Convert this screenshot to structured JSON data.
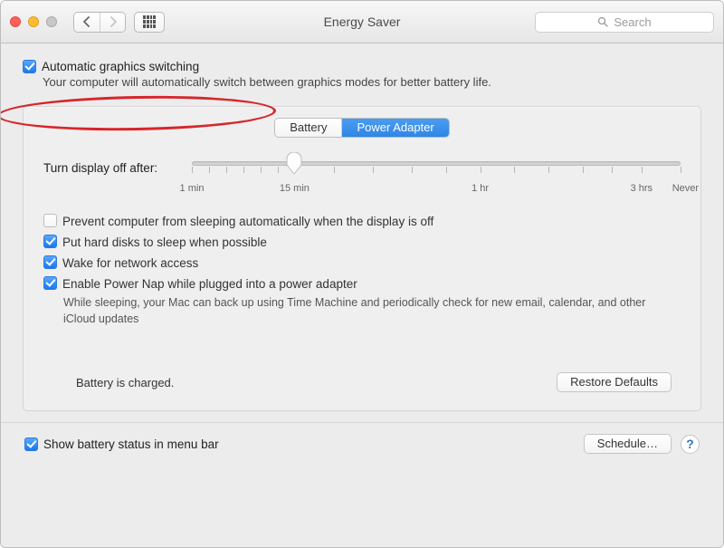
{
  "window": {
    "title": "Energy Saver"
  },
  "search": {
    "placeholder": "Search"
  },
  "auto_graphics": {
    "label": "Automatic graphics switching",
    "checked": true,
    "description": "Your computer will automatically switch between graphics modes for better battery life."
  },
  "tabs": {
    "battery": "Battery",
    "power_adapter": "Power Adapter",
    "active": "power_adapter"
  },
  "slider": {
    "label": "Turn display off after:",
    "ticks": {
      "min": "1 min",
      "mid": "15 min",
      "hour": "1 hr",
      "max": "3 hrs",
      "never": "Never"
    },
    "value_pct": 21
  },
  "options": {
    "prevent_sleep": {
      "label": "Prevent computer from sleeping automatically when the display is off",
      "checked": false
    },
    "hdd_sleep": {
      "label": "Put hard disks to sleep when possible",
      "checked": true
    },
    "wake_network": {
      "label": "Wake for network access",
      "checked": true
    },
    "power_nap": {
      "label": "Enable Power Nap while plugged into a power adapter",
      "checked": true,
      "sub": "While sleeping, your Mac can back up using Time Machine and periodically check for new email, calendar, and other iCloud updates"
    }
  },
  "battery_status": "Battery is charged.",
  "buttons": {
    "restore_defaults": "Restore Defaults",
    "schedule": "Schedule…"
  },
  "show_menubar": {
    "label": "Show battery status in menu bar",
    "checked": true
  },
  "help": "?"
}
